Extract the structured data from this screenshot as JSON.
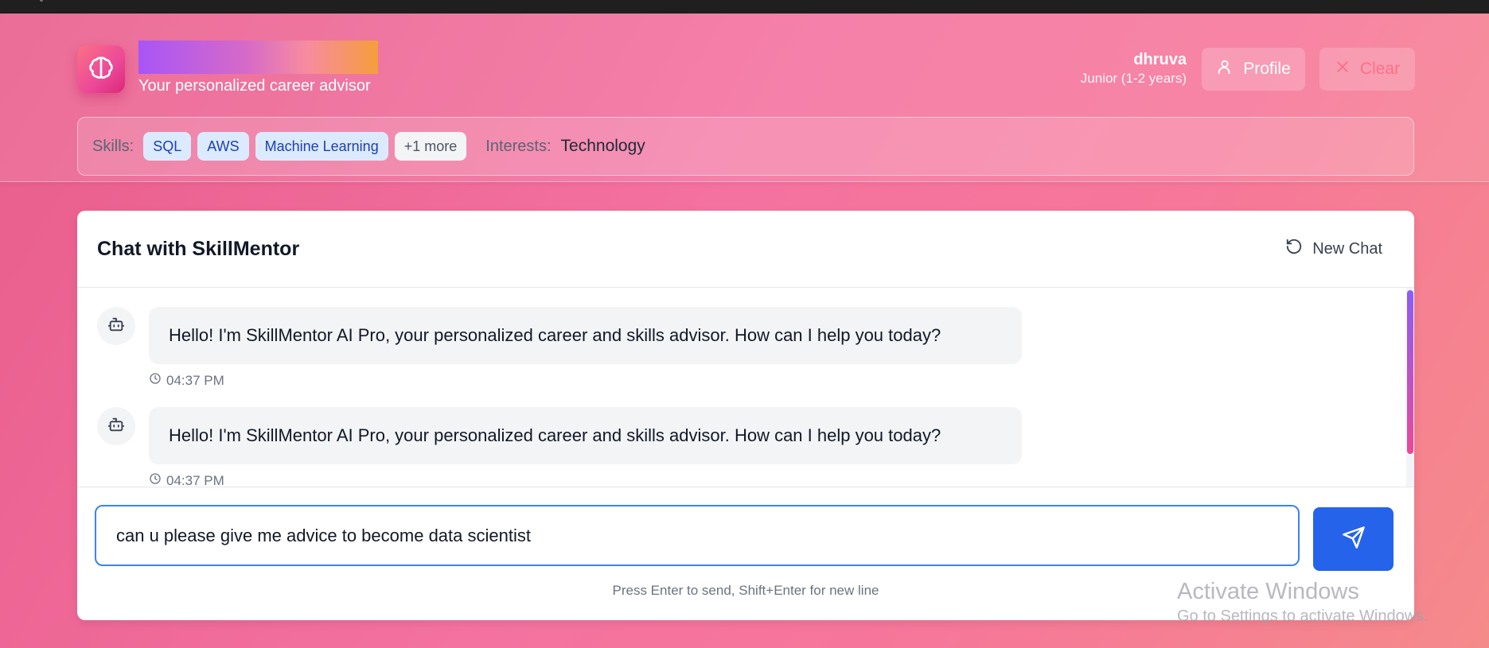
{
  "app": {
    "tagline": "Your personalized career advisor",
    "brand_gradient": [
      "#a855f7",
      "#f59e3c"
    ]
  },
  "user": {
    "name": "dhruva",
    "level": "Junior (1-2 years)"
  },
  "header": {
    "profile_label": "Profile",
    "clear_label": "Clear"
  },
  "skills": {
    "label": "Skills:",
    "chips": [
      "SQL",
      "AWS",
      "Machine Learning"
    ],
    "more": "+1 more",
    "interests_label": "Interests:",
    "interests": "Technology"
  },
  "chat": {
    "title": "Chat with SkillMentor",
    "new_chat_label": "New Chat",
    "messages": [
      {
        "text": "Hello! I'm SkillMentor AI Pro, your personalized career and skills advisor. How can I help you today?",
        "time": "04:37 PM"
      },
      {
        "text": "Hello! I'm SkillMentor AI Pro, your personalized career and skills advisor. How can I help you today?",
        "time": "04:37 PM"
      }
    ],
    "input_value": "can u please give me advice to become data scientist",
    "hint": "Press Enter to send, Shift+Enter for new line"
  },
  "watermark": {
    "line1": "Activate Windows",
    "line2": "Go to Settings to activate Windows."
  },
  "icons": {
    "logo": "brain-icon",
    "profile": "user-icon",
    "clear": "x-icon",
    "new_chat": "rotate-ccw-icon",
    "bot": "bot-icon",
    "time": "clock-icon",
    "send": "send-icon"
  },
  "colors": {
    "accent_blue": "#2563eb",
    "chip_bg": "#dbeafe",
    "chip_text": "#1e40af",
    "clear_text": "#fb7185"
  }
}
